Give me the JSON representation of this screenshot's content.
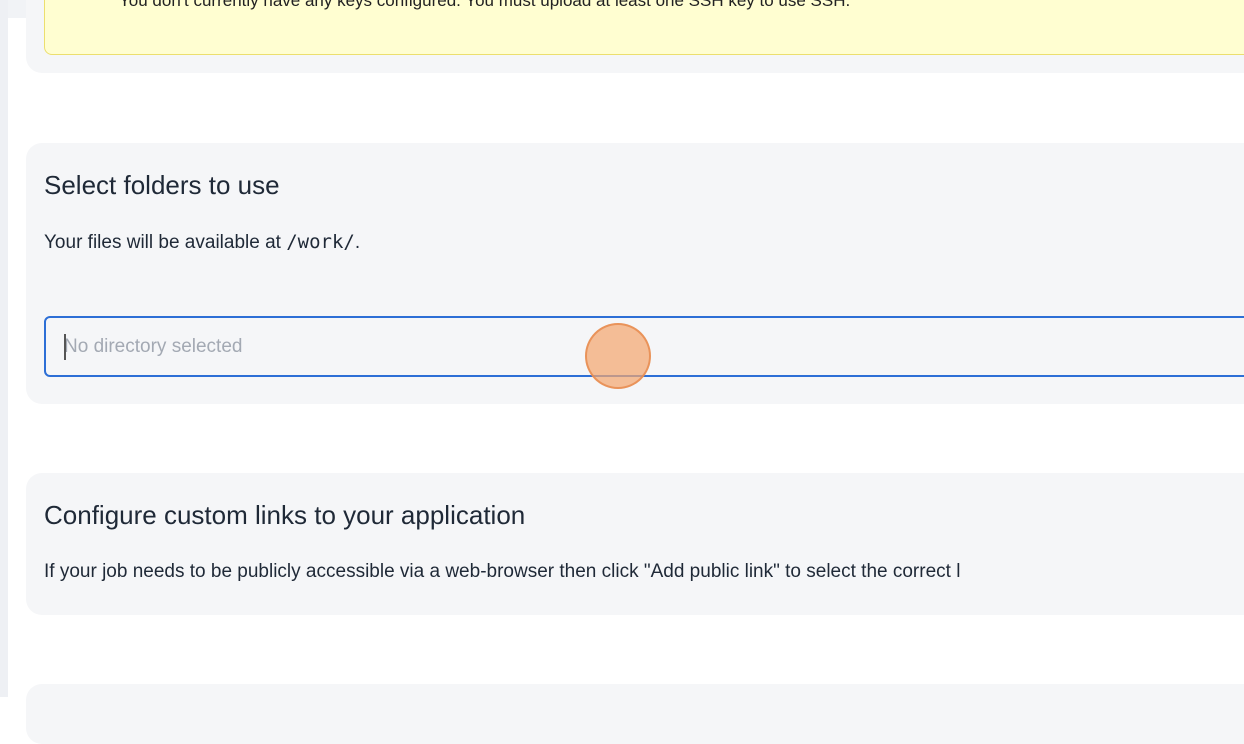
{
  "ssh_section": {
    "warning_text": "You don't currently have any keys configured. You must upload at least one SSH key to use SSH."
  },
  "folders_section": {
    "title": "Select folders to use",
    "description_prefix": "Your files will be available at ",
    "mount_path": "/work/",
    "description_suffix": ".",
    "directory_input": {
      "value": "",
      "placeholder": "No directory selected"
    }
  },
  "links_section": {
    "title": "Configure custom links to your application",
    "description": "If your job needs to be publicly accessible via a web-browser then click \"Add public link\" to select the correct l"
  },
  "colors": {
    "focus_border": "#2d6fd6",
    "warning_background": "#fffed1",
    "panel_background": "#f5f6f8",
    "click_marker": "#f4a670"
  }
}
